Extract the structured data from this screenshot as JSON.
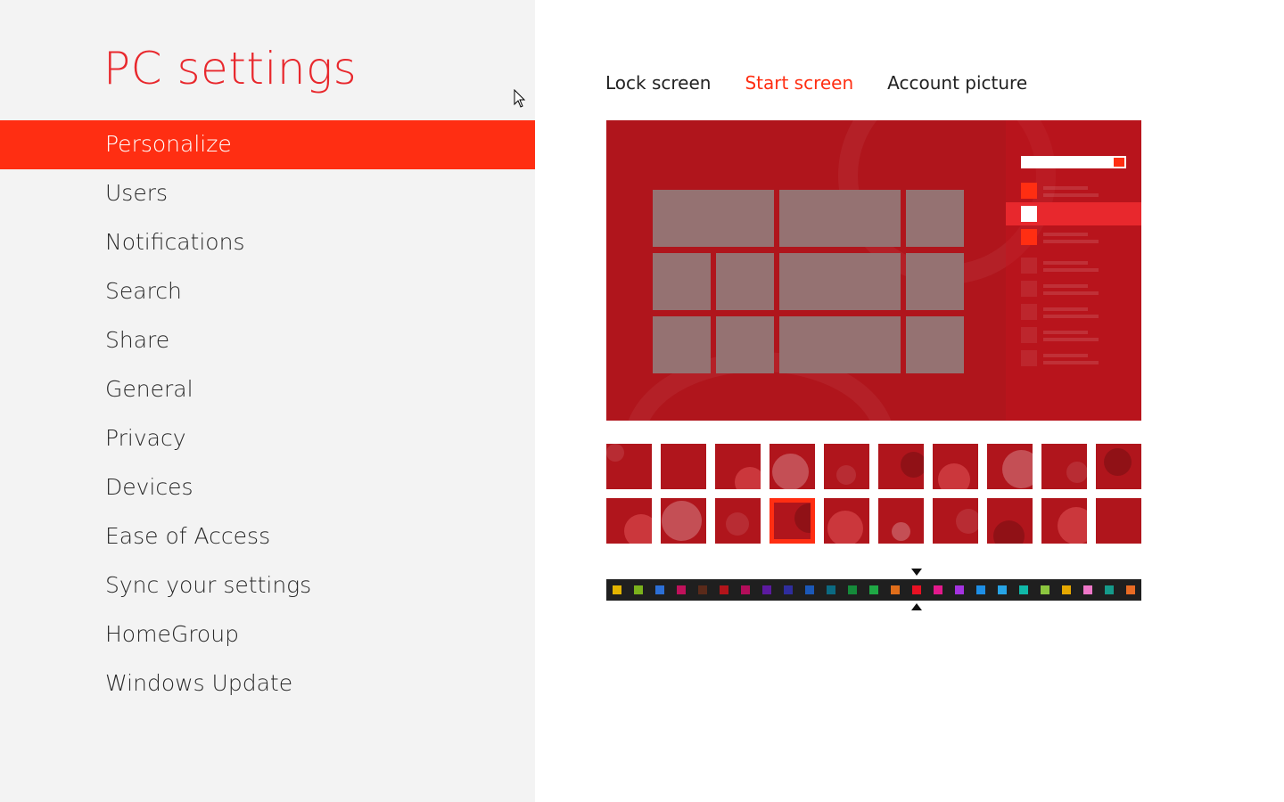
{
  "app": {
    "title": "PC settings"
  },
  "sidebar": {
    "items": [
      {
        "label": "Personalize",
        "active": true
      },
      {
        "label": "Users"
      },
      {
        "label": "Notifications"
      },
      {
        "label": "Search"
      },
      {
        "label": "Share"
      },
      {
        "label": "General"
      },
      {
        "label": "Privacy"
      },
      {
        "label": "Devices"
      },
      {
        "label": "Ease of Access"
      },
      {
        "label": "Sync your settings"
      },
      {
        "label": "HomeGroup"
      },
      {
        "label": "Windows Update"
      }
    ]
  },
  "tabs": [
    {
      "label": "Lock screen"
    },
    {
      "label": "Start screen",
      "active": true
    },
    {
      "label": "Account picture"
    }
  ],
  "colors": {
    "accent": "#ff2e12",
    "title_red": "#e8282d",
    "background_red": "#b0151c",
    "tile_gray": "#957272"
  },
  "background_patterns": {
    "count": 20,
    "selected_index": 13
  },
  "color_swatches": [
    "#e3b400",
    "#7bb21c",
    "#2c6fd6",
    "#c0115b",
    "#5a2a1a",
    "#b3141a",
    "#b30d5a",
    "#5c1aa0",
    "#2f2d9e",
    "#1b58b8",
    "#0b6a82",
    "#158a3a",
    "#1fa845",
    "#e06e1a",
    "#e81123",
    "#e3198c",
    "#a533e0",
    "#1e8fe6",
    "#27a4e6",
    "#10b8a8",
    "#8cc63f",
    "#e6a800",
    "#ee77c8",
    "#159a8a",
    "#e86b24"
  ],
  "selected_color_index": 14
}
